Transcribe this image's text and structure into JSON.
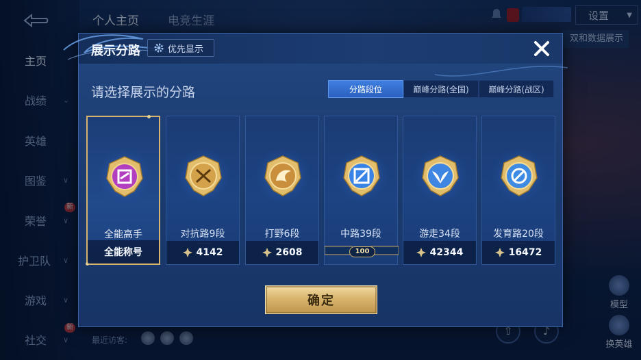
{
  "background": {
    "top_tabs": [
      "个人主页",
      "电竞生涯"
    ],
    "settings_label": "设置",
    "right_ribbon": "双和数据展示",
    "nav_items": [
      {
        "label": "主页",
        "active": true
      },
      {
        "label": "战绩"
      },
      {
        "label": "英雄"
      },
      {
        "label": "图鉴",
        "chevron": true
      },
      {
        "label": "荣誉",
        "chevron": true,
        "new": "新"
      },
      {
        "label": "护卫队",
        "chevron": true
      },
      {
        "label": "游戏",
        "chevron": true
      },
      {
        "label": "社交",
        "chevron": true,
        "new": "新"
      }
    ],
    "visitors_label": "最近访客:",
    "side_actions": [
      "模型",
      "换英雄"
    ]
  },
  "modal": {
    "title": "展示分路",
    "priority_button": "优先显示",
    "subtitle": "请选择展示的分路",
    "tabs": [
      {
        "label": "分路段位",
        "active": true
      },
      {
        "label": "巅峰分路(全国)",
        "active": false
      },
      {
        "label": "巅峰分路(战区)",
        "active": false
      }
    ],
    "cards": [
      {
        "name": "全能高手",
        "bottom": "全能称号",
        "selected": true,
        "emblem_color": "#b23fc0"
      },
      {
        "name": "对抗路9段",
        "score": "4142",
        "emblem_color": "#d4a24a"
      },
      {
        "name": "打野6段",
        "score": "2608",
        "emblem_color": "#c98f3c"
      },
      {
        "name": "中路39段",
        "badge": "100",
        "emblem_color": "#3a83e6"
      },
      {
        "name": "游走34段",
        "score": "42344",
        "emblem_color": "#3f86e2"
      },
      {
        "name": "发育路20段",
        "score": "16472",
        "emblem_color": "#3e8be3"
      }
    ],
    "confirm_label": "确定"
  },
  "colors": {
    "gold": "#d7b56e",
    "tab_active": "#3f7fe0",
    "modal_bg": "#1d4182"
  }
}
